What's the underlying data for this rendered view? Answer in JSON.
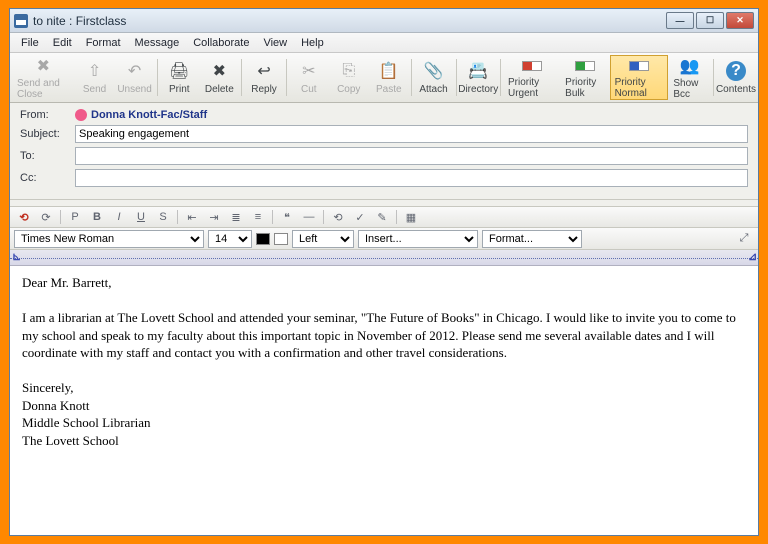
{
  "window": {
    "title": "to nite : Firstclass"
  },
  "menu": [
    "File",
    "Edit",
    "Format",
    "Message",
    "Collaborate",
    "View",
    "Help"
  ],
  "toolbar": [
    {
      "name": "send-and-close",
      "label": "Send and Close",
      "icon": "✖",
      "disabled": true
    },
    {
      "name": "send",
      "label": "Send",
      "icon": "⇧",
      "disabled": true
    },
    {
      "name": "unsend",
      "label": "Unsend",
      "icon": "↶",
      "disabled": true
    },
    {
      "name": "print",
      "label": "Print",
      "icon": "🖨"
    },
    {
      "name": "delete",
      "label": "Delete",
      "icon": "✖"
    },
    {
      "name": "reply",
      "label": "Reply",
      "icon": "↩"
    },
    {
      "name": "cut",
      "label": "Cut",
      "icon": "✂",
      "disabled": true
    },
    {
      "name": "copy",
      "label": "Copy",
      "icon": "⎘",
      "disabled": true
    },
    {
      "name": "paste",
      "label": "Paste",
      "icon": "📋",
      "disabled": true
    },
    {
      "name": "attach",
      "label": "Attach",
      "icon": "📎"
    },
    {
      "name": "directory",
      "label": "Directory",
      "icon": "📇"
    },
    {
      "name": "priority-urgent",
      "label": "Priority Urgent",
      "icon": "red"
    },
    {
      "name": "priority-bulk",
      "label": "Priority Bulk",
      "icon": "green"
    },
    {
      "name": "priority-normal",
      "label": "Priority Normal",
      "icon": "blue",
      "active": true
    },
    {
      "name": "show-bcc",
      "label": "Show Bcc",
      "icon": "👥"
    },
    {
      "name": "contents",
      "label": "Contents",
      "icon": "?"
    }
  ],
  "headers": {
    "from_label": "From:",
    "from_value": "Donna Knott-Fac/Staff",
    "subject_label": "Subject:",
    "subject_value": "Speaking engagement",
    "to_label": "To:",
    "to_value": "",
    "cc_label": "Cc:",
    "cc_value": ""
  },
  "format_controls": {
    "font": "Times New Roman",
    "size": "14",
    "align": "Left",
    "insert": "Insert...",
    "format": "Format..."
  },
  "body": {
    "greeting": "Dear Mr. Barrett,",
    "para": "I am a librarian at The Lovett School and attended your seminar, \"The Future of Books\" in Chicago.  I would like to invite you to come to my school and speak to my faculty about this important topic in November of 2012.  Please send me several available dates and I will coordinate with my staff and contact you with a confirmation and other travel considerations.",
    "closing": "Sincerely,",
    "sig1": "Donna Knott",
    "sig2": "Middle School Librarian",
    "sig3": "The Lovett School"
  }
}
